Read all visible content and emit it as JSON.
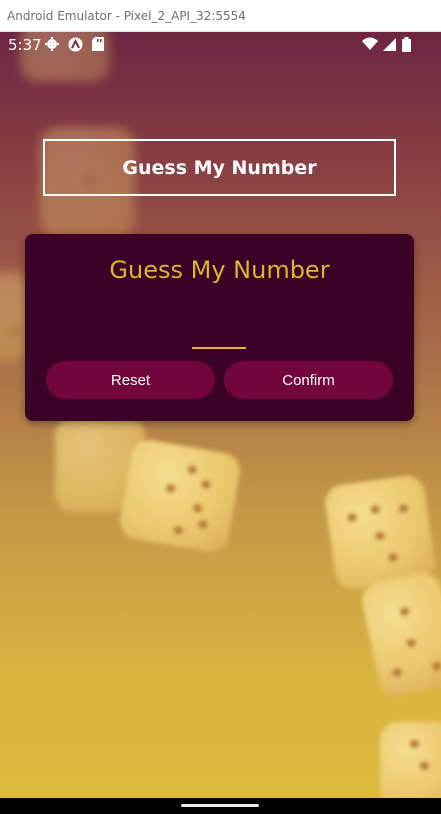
{
  "window": {
    "title": "Android Emulator - Pixel_2_API_32:5554"
  },
  "status_bar": {
    "time": "5:37",
    "left_icons": [
      "settings-gear-icon",
      "app-a-icon",
      "sd-card-icon"
    ],
    "right_icons": [
      "wifi-icon",
      "cell-signal-icon",
      "battery-icon"
    ]
  },
  "screen": {
    "title": "Guess My Number",
    "card": {
      "heading": "Guess My Number",
      "input_value": "",
      "reset_label": "Reset",
      "confirm_label": "Confirm"
    }
  },
  "colors": {
    "card_bg": "#3b0127",
    "accent_gold": "#ddb52f",
    "button_bg": "#72063c",
    "gradient_top": "#6e2644",
    "gradient_bottom": "#ddb83c"
  }
}
